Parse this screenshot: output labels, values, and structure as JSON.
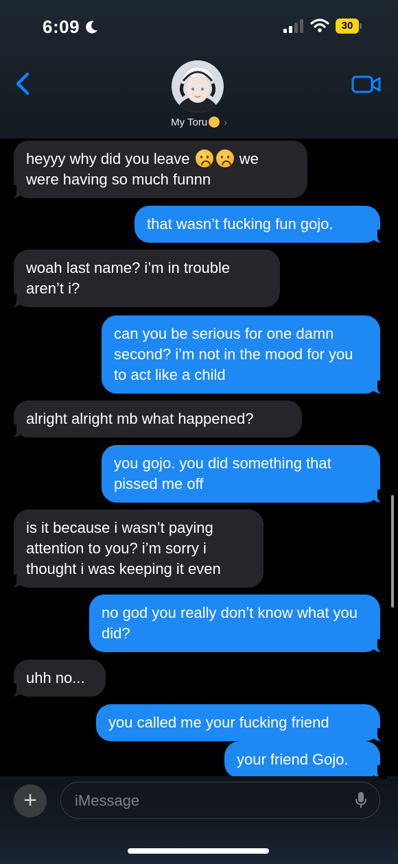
{
  "status_bar": {
    "time": "6:09",
    "battery": "30"
  },
  "header": {
    "contact_name": "My Toru"
  },
  "messages": [
    {
      "direction": "in",
      "text_before": "heyyy why did you leave",
      "text_after": "we were having so much funnn"
    },
    {
      "direction": "out",
      "text": "that wasn’t fucking fun gojo."
    },
    {
      "direction": "in",
      "text": "woah last name? i’m in trouble aren’t i?"
    },
    {
      "direction": "out",
      "text": "can you be serious for one damn second? i’m not in the mood for you to act like a child"
    },
    {
      "direction": "in",
      "text": "alright alright mb what happened?"
    },
    {
      "direction": "out",
      "text": "you gojo. you did something that pissed me off"
    },
    {
      "direction": "in",
      "text": "is it because i wasn’t paying attention to you? i’m sorry i thought i was keeping it even"
    },
    {
      "direction": "out",
      "text": "no god you really don’t know what you did?"
    },
    {
      "direction": "in",
      "text": "uhh no..."
    },
    {
      "direction": "out",
      "text": "you called me your fucking friend"
    },
    {
      "direction": "out",
      "text": "your friend Gojo."
    }
  ],
  "composer": {
    "placeholder": "iMessage",
    "plus_label": "+"
  },
  "colors": {
    "outgoing_bubble": "#1e88f5",
    "incoming_bubble": "#26252a",
    "accent": "#0a84ff"
  }
}
